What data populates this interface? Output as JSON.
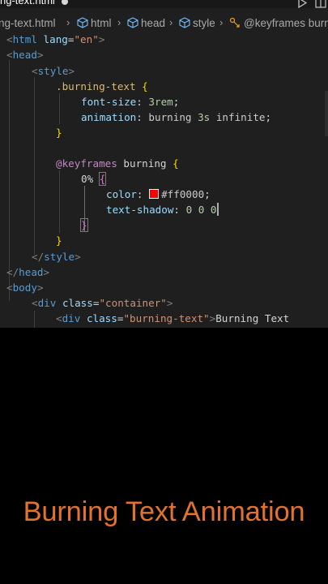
{
  "tab": {
    "filename": "ng-text.html"
  },
  "breadcrumb": [
    {
      "label": "ng-text.html",
      "icon": "none"
    },
    {
      "label": "html",
      "icon": "cube-icon"
    },
    {
      "label": "head",
      "icon": "cube-icon"
    },
    {
      "label": "style",
      "icon": "cube-icon"
    },
    {
      "label": "@keyframes burni",
      "icon": "selector-icon"
    }
  ],
  "code": {
    "l1": {
      "open": "<",
      "tag": "html",
      "sp": " ",
      "attr": "lang",
      "eq": "=",
      "str": "\"en\"",
      "close": ">"
    },
    "l2": {
      "open": "<",
      "tag": "head",
      "close": ">"
    },
    "l3": {
      "open": "<",
      "tag": "style",
      "close": ">"
    },
    "l4": {
      "sel": ".burning-text",
      "brace": " {"
    },
    "l5": {
      "prop": "font-size",
      "colon": ": ",
      "num": "3rem",
      "semi": ";"
    },
    "l6": {
      "prop": "animation",
      "colon": ": ",
      "v1": "burning ",
      "num": "3s",
      "v2": " infinite",
      "semi": ";"
    },
    "l7": {
      "brace": "}"
    },
    "l8": {
      "at": "@keyframes",
      "name": " burning",
      "brace": " {"
    },
    "l9": {
      "pct": "0%",
      "sp": " ",
      "brace": "{"
    },
    "l10": {
      "prop": "color",
      "colon": ": ",
      "val": "#ff0000",
      "semi": ";"
    },
    "l11": {
      "prop": "text-shadow",
      "colon": ": ",
      "num": "0 0 0"
    },
    "l12": {
      "brace": "}"
    },
    "l13": {
      "brace": "}"
    },
    "l14": {
      "open": "</",
      "tag": "style",
      "close": ">"
    },
    "l15": {
      "open": "</",
      "tag": "head",
      "close": ">"
    },
    "l16": {
      "open": "<",
      "tag": "body",
      "close": ">"
    },
    "l17": {
      "open": "<",
      "tag": "div",
      "sp": " ",
      "attr": "class",
      "eq": "=",
      "str": "\"container\"",
      "close": ">"
    },
    "l18": {
      "open": "<",
      "tag": "div",
      "sp": " ",
      "attr": "class",
      "eq": "=",
      "str": "\"burning-text\"",
      "close": ">",
      "text": "Burning Text"
    }
  },
  "swatch_color": "#ff0000",
  "caption": "Burning Text Animation"
}
